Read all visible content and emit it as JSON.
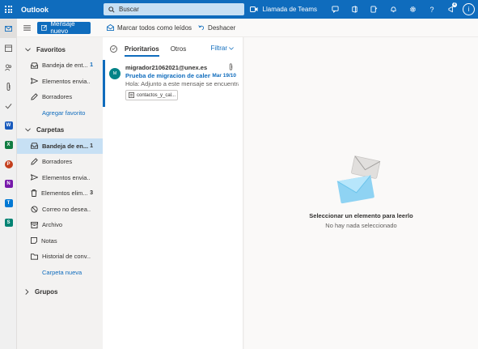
{
  "header": {
    "app_name": "Outlook",
    "search_placeholder": "Buscar",
    "teams_call": "Llamada de Teams",
    "notification_count": "4",
    "user_initial": "i"
  },
  "commands": {
    "new_mail": "Mensaje nuevo",
    "mark_all_read": "Marcar todos como leídos",
    "undo": "Deshacer"
  },
  "favorites": {
    "title": "Favoritos",
    "items": [
      {
        "label": "Bandeja de ent...",
        "count": "1"
      },
      {
        "label": "Elementos envia...",
        "count": ""
      },
      {
        "label": "Borradores",
        "count": ""
      }
    ],
    "add_link": "Agregar favorito"
  },
  "folders": {
    "title": "Carpetas",
    "items": [
      {
        "label": "Bandeja de en...",
        "count": "1"
      },
      {
        "label": "Borradores",
        "count": ""
      },
      {
        "label": "Elementos envia...",
        "count": ""
      },
      {
        "label": "Elementos elim...",
        "count": "3"
      },
      {
        "label": "Correo no desea...",
        "count": ""
      },
      {
        "label": "Archivo",
        "count": ""
      },
      {
        "label": "Notas",
        "count": ""
      },
      {
        "label": "Historial de conv...",
        "count": ""
      }
    ],
    "new_folder_link": "Carpeta nueva"
  },
  "groups": {
    "title": "Grupos"
  },
  "message_list": {
    "tab_focused": "Prioritarios",
    "tab_other": "Otros",
    "filter": "Filtrar",
    "messages": [
      {
        "avatar": "M",
        "from": "migrador21062021@unex.es",
        "subject": "Prueba de migracion de calend...",
        "date": "Mar 19/10",
        "preview": "Hola: Adjunto a este mensaje se encuentra ...",
        "attachment": "contactos_y_cal..."
      }
    ]
  },
  "reading_pane": {
    "title": "Seleccionar un elemento para leerlo",
    "subtitle": "No hay nada seleccionado"
  },
  "colors": {
    "brand": "#0f6cbd",
    "selected_folder": "#c7e0f4",
    "avatar": "#038387"
  }
}
